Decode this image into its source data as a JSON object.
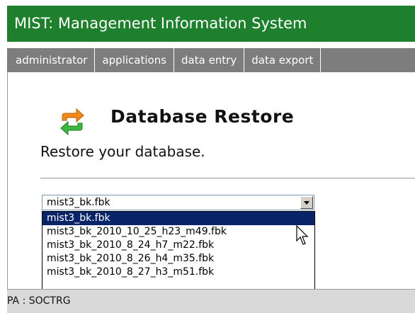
{
  "header": {
    "title": "MIST: Management Information System"
  },
  "nav": {
    "items": [
      {
        "label": "administrator"
      },
      {
        "label": "applications"
      },
      {
        "label": "data entry"
      },
      {
        "label": "data export"
      }
    ]
  },
  "main": {
    "icon": "restore-arrows-icon",
    "title": "Database Restore",
    "subtitle": "Restore your database."
  },
  "backup_select": {
    "selected": "mist3_bk.fbk",
    "options": [
      {
        "label": "mist3_bk.fbk",
        "selected": true
      },
      {
        "label": "mist3_bk_2010_10_25_h23_m49.fbk",
        "selected": false
      },
      {
        "label": "mist3_bk_2010_8_24_h7_m22.fbk",
        "selected": false
      },
      {
        "label": "mist3_bk_2010_8_26_h4_m35.fbk",
        "selected": false
      },
      {
        "label": "mist3_bk_2010_8_27_h3_m51.fbk",
        "selected": false
      }
    ]
  },
  "status": {
    "text": "PA : SOCTRG"
  },
  "colors": {
    "header_bg": "#1e7f2c",
    "nav_bg": "#7d7d7d",
    "selection_bg": "#0a246a",
    "status_bg": "#d9d9d9"
  }
}
